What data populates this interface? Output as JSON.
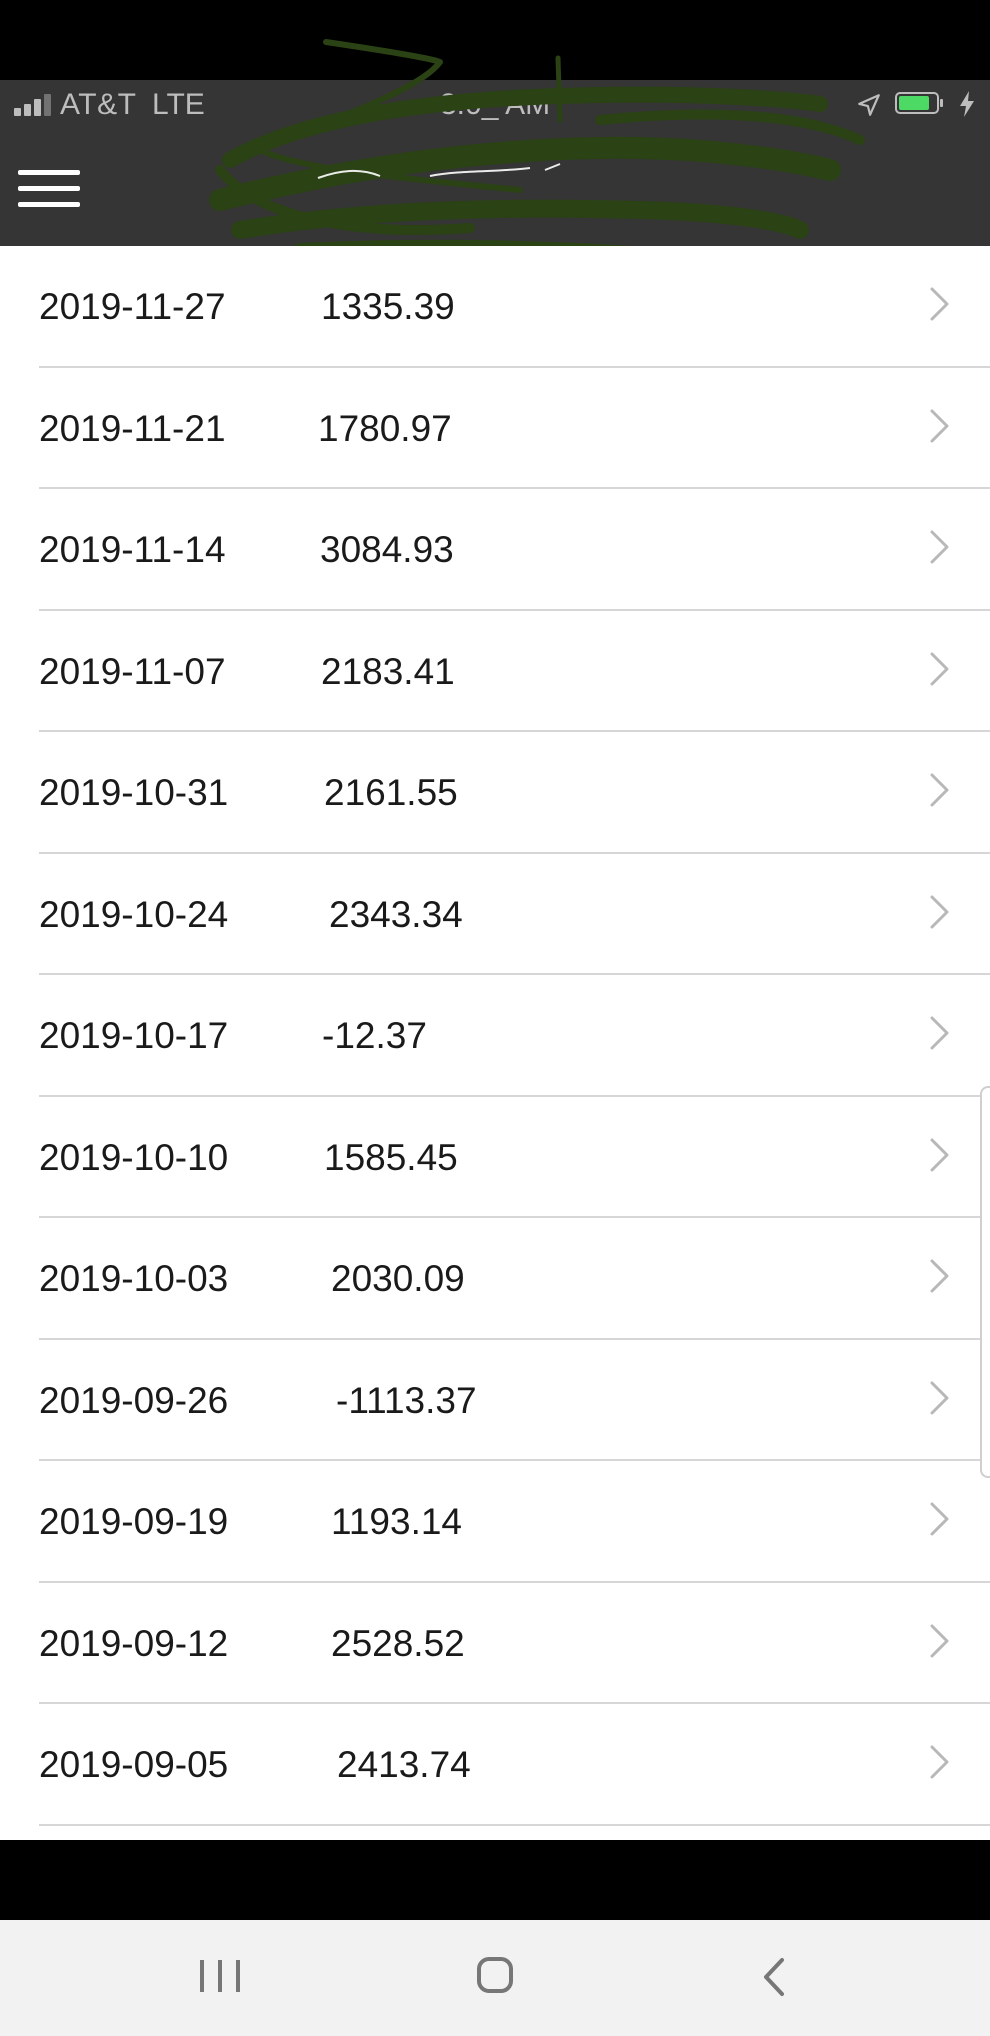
{
  "status_bar": {
    "carrier": "AT&T",
    "network": "LTE",
    "time": "3:0_ AM",
    "icons": [
      "signal-icon",
      "location-arrow-icon",
      "battery-icon",
      "charging-bolt-icon"
    ],
    "battery_color": "#4cd964"
  },
  "nav_bar": {
    "menu_icon": "hamburger-menu-icon",
    "title_obscured": true
  },
  "colors": {
    "header_bg": "#353535",
    "scribble": "#2a4214",
    "divider": "#d6d6d6",
    "text": "#1a1a1a",
    "chevron": "#b8b8b8"
  },
  "rows": [
    {
      "date": "2019-11-27",
      "amount": "1335.39"
    },
    {
      "date": "2019-11-21",
      "amount": "1780.97"
    },
    {
      "date": "2019-11-14",
      "amount": "3084.93"
    },
    {
      "date": "2019-11-07",
      "amount": "2183.41"
    },
    {
      "date": "2019-10-31",
      "amount": "2161.55"
    },
    {
      "date": "2019-10-24",
      "amount": "2343.34"
    },
    {
      "date": "2019-10-17",
      "amount": "-12.37"
    },
    {
      "date": "2019-10-10",
      "amount": "1585.45"
    },
    {
      "date": "2019-10-03",
      "amount": "2030.09"
    },
    {
      "date": "2019-09-26",
      "amount": "-1113.37"
    },
    {
      "date": "2019-09-19",
      "amount": "1193.14"
    },
    {
      "date": "2019-09-12",
      "amount": "2528.52"
    },
    {
      "date": "2019-09-05",
      "amount": "2413.74"
    }
  ],
  "system_nav": {
    "icons": [
      "recent-apps-icon",
      "home-icon",
      "back-icon"
    ]
  }
}
